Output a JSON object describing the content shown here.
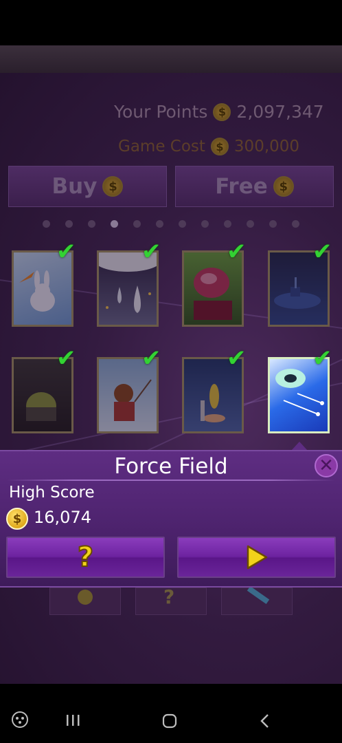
{
  "points": {
    "label": "Your Points",
    "value": "2,097,347"
  },
  "cost": {
    "label": "Game Cost",
    "value": "300,000"
  },
  "buttons": {
    "buy": "Buy",
    "free": "Free"
  },
  "coin_symbol": "$",
  "page_indicator": {
    "total": 12,
    "active_index": 3
  },
  "cards": [
    {
      "name": "card-bunny",
      "unlocked": true
    },
    {
      "name": "card-raindrops",
      "unlocked": true
    },
    {
      "name": "card-radish",
      "unlocked": true
    },
    {
      "name": "card-submarine",
      "unlocked": true
    },
    {
      "name": "card-helmet",
      "unlocked": true
    },
    {
      "name": "card-bear",
      "unlocked": true
    },
    {
      "name": "card-rocket",
      "unlocked": true
    },
    {
      "name": "card-force-field",
      "unlocked": true,
      "selected": true
    }
  ],
  "popup": {
    "title": "Force Field",
    "high_score_label": "High Score",
    "high_score_value": "16,074",
    "help_label": "?",
    "close_icon": "close-icon",
    "play_icon": "play-icon"
  },
  "colors": {
    "check": "#33d233",
    "coin": "#e0a81c",
    "popup": "#5e2d82",
    "play": "#f2d21a"
  },
  "nav": {
    "icons": [
      "game-launcher-icon",
      "recent-apps-icon",
      "home-icon",
      "back-icon"
    ]
  }
}
